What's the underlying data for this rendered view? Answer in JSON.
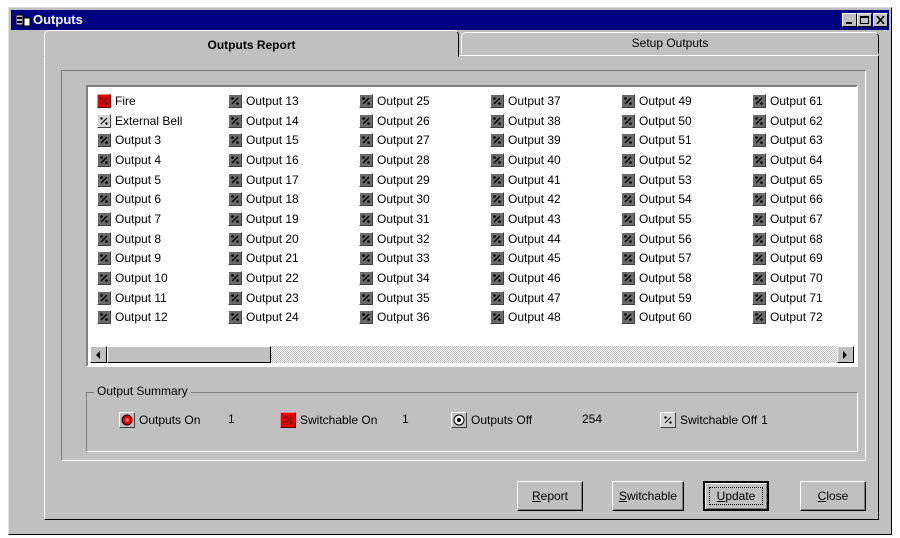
{
  "window": {
    "title": "Outputs"
  },
  "tabs": [
    {
      "label": "Outputs Report",
      "active": true
    },
    {
      "label": "Setup Outputs",
      "active": false
    }
  ],
  "outputs": [
    {
      "label": "Fire",
      "state": "switchable-on"
    },
    {
      "label": "External Bell",
      "state": "switchable-off"
    },
    {
      "label": "Output 3",
      "state": "off"
    },
    {
      "label": "Output 4",
      "state": "off"
    },
    {
      "label": "Output 5",
      "state": "off"
    },
    {
      "label": "Output 6",
      "state": "off"
    },
    {
      "label": "Output 7",
      "state": "off"
    },
    {
      "label": "Output 8",
      "state": "off"
    },
    {
      "label": "Output 9",
      "state": "off"
    },
    {
      "label": "Output 10",
      "state": "off"
    },
    {
      "label": "Output 11",
      "state": "off"
    },
    {
      "label": "Output 12",
      "state": "off"
    },
    {
      "label": "Output 13",
      "state": "off"
    },
    {
      "label": "Output 14",
      "state": "off"
    },
    {
      "label": "Output 15",
      "state": "off"
    },
    {
      "label": "Output 16",
      "state": "off"
    },
    {
      "label": "Output 17",
      "state": "off"
    },
    {
      "label": "Output 18",
      "state": "off"
    },
    {
      "label": "Output 19",
      "state": "off"
    },
    {
      "label": "Output 20",
      "state": "off"
    },
    {
      "label": "Output 21",
      "state": "off"
    },
    {
      "label": "Output 22",
      "state": "off"
    },
    {
      "label": "Output 23",
      "state": "off"
    },
    {
      "label": "Output 24",
      "state": "off"
    },
    {
      "label": "Output 25",
      "state": "off"
    },
    {
      "label": "Output 26",
      "state": "off"
    },
    {
      "label": "Output 27",
      "state": "off"
    },
    {
      "label": "Output 28",
      "state": "off"
    },
    {
      "label": "Output 29",
      "state": "off"
    },
    {
      "label": "Output 30",
      "state": "off"
    },
    {
      "label": "Output 31",
      "state": "off"
    },
    {
      "label": "Output 32",
      "state": "off"
    },
    {
      "label": "Output 33",
      "state": "off"
    },
    {
      "label": "Output 34",
      "state": "off"
    },
    {
      "label": "Output 35",
      "state": "off"
    },
    {
      "label": "Output 36",
      "state": "off"
    },
    {
      "label": "Output 37",
      "state": "off"
    },
    {
      "label": "Output 38",
      "state": "off"
    },
    {
      "label": "Output 39",
      "state": "off"
    },
    {
      "label": "Output 40",
      "state": "off"
    },
    {
      "label": "Output 41",
      "state": "off"
    },
    {
      "label": "Output 42",
      "state": "off"
    },
    {
      "label": "Output 43",
      "state": "off"
    },
    {
      "label": "Output 44",
      "state": "off"
    },
    {
      "label": "Output 45",
      "state": "off"
    },
    {
      "label": "Output 46",
      "state": "off"
    },
    {
      "label": "Output 47",
      "state": "off"
    },
    {
      "label": "Output 48",
      "state": "off"
    },
    {
      "label": "Output 49",
      "state": "off"
    },
    {
      "label": "Output 50",
      "state": "off"
    },
    {
      "label": "Output 51",
      "state": "off"
    },
    {
      "label": "Output 52",
      "state": "off"
    },
    {
      "label": "Output 53",
      "state": "off"
    },
    {
      "label": "Output 54",
      "state": "off"
    },
    {
      "label": "Output 55",
      "state": "off"
    },
    {
      "label": "Output 56",
      "state": "off"
    },
    {
      "label": "Output 57",
      "state": "off"
    },
    {
      "label": "Output 58",
      "state": "off"
    },
    {
      "label": "Output 59",
      "state": "off"
    },
    {
      "label": "Output 60",
      "state": "off"
    },
    {
      "label": "Output 61",
      "state": "off"
    },
    {
      "label": "Output 62",
      "state": "off"
    },
    {
      "label": "Output 63",
      "state": "off"
    },
    {
      "label": "Output 64",
      "state": "off"
    },
    {
      "label": "Output 65",
      "state": "off"
    },
    {
      "label": "Output 66",
      "state": "off"
    },
    {
      "label": "Output 67",
      "state": "off"
    },
    {
      "label": "Output 68",
      "state": "off"
    },
    {
      "label": "Output 69",
      "state": "off"
    },
    {
      "label": "Output 70",
      "state": "off"
    },
    {
      "label": "Output 71",
      "state": "off"
    },
    {
      "label": "Output 72",
      "state": "off"
    }
  ],
  "summary": {
    "title": "Output Summary",
    "outputs_on_label": "Outputs On",
    "outputs_on_value": "1",
    "switchable_on_label": "Switchable On",
    "switchable_on_value": "1",
    "outputs_off_label": "Outputs Off",
    "outputs_off_value": "254",
    "switchable_off_label": "Switchable Off",
    "switchable_off_value": "1"
  },
  "buttons": {
    "report": {
      "accel": "R",
      "rest": "eport"
    },
    "switchable": {
      "accel": "S",
      "rest": "witchable"
    },
    "update": {
      "accel": "U",
      "rest": "pdate"
    },
    "close": {
      "accel": "C",
      "rest": "lose"
    }
  },
  "colors": {
    "titlebar": "#000080",
    "face": "#c0c0c0",
    "switchable_on": "#e00000",
    "output_off": "#6a6a6a"
  },
  "icons": {
    "off": "output-off-icon",
    "switchable_on": "switchable-on-icon",
    "switchable_off": "switchable-off-icon",
    "on": "output-on-icon"
  }
}
